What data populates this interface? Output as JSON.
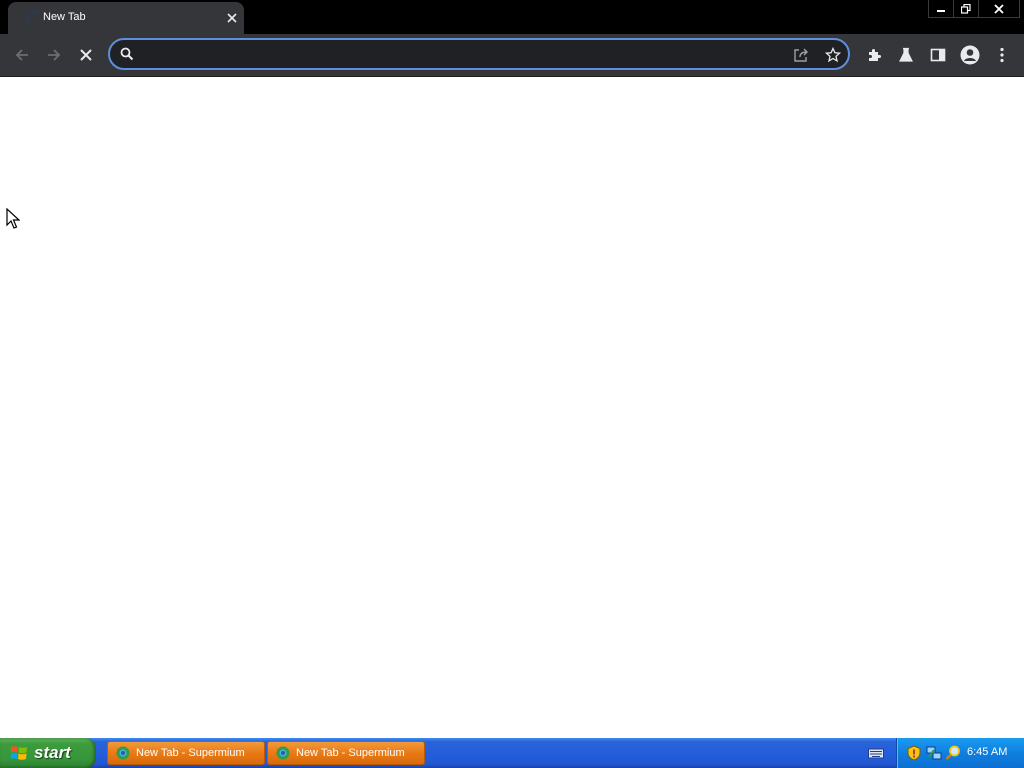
{
  "browser": {
    "tab": {
      "title": "New Tab",
      "close_icon": "close-icon"
    },
    "window_controls": [
      "minimize-icon",
      "restore-icon",
      "close-icon"
    ],
    "toolbar": {
      "back_icon": "arrow-left-icon",
      "forward_icon": "arrow-right-icon",
      "stop_icon": "stop-loading-icon",
      "address": {
        "value": "",
        "placeholder": ""
      },
      "share_icon": "share-icon",
      "bookmark_icon": "star-icon",
      "extensions_icon": "puzzle-icon",
      "labs_icon": "flask-icon",
      "side_panel_icon": "side-panel-icon",
      "profile_icon": "avatar-icon",
      "menu_icon": "kebab-menu-icon"
    },
    "accent_color": "#5f8fdc"
  },
  "taskbar": {
    "start_label": "start",
    "tasks": [
      {
        "label": "New Tab - Supermium"
      },
      {
        "label": "New Tab - Supermium"
      }
    ],
    "tray": {
      "icons": [
        "keyboard-icon",
        "security-shield-icon",
        "network-icon",
        "search-icon"
      ],
      "clock": "6:45 AM"
    }
  }
}
